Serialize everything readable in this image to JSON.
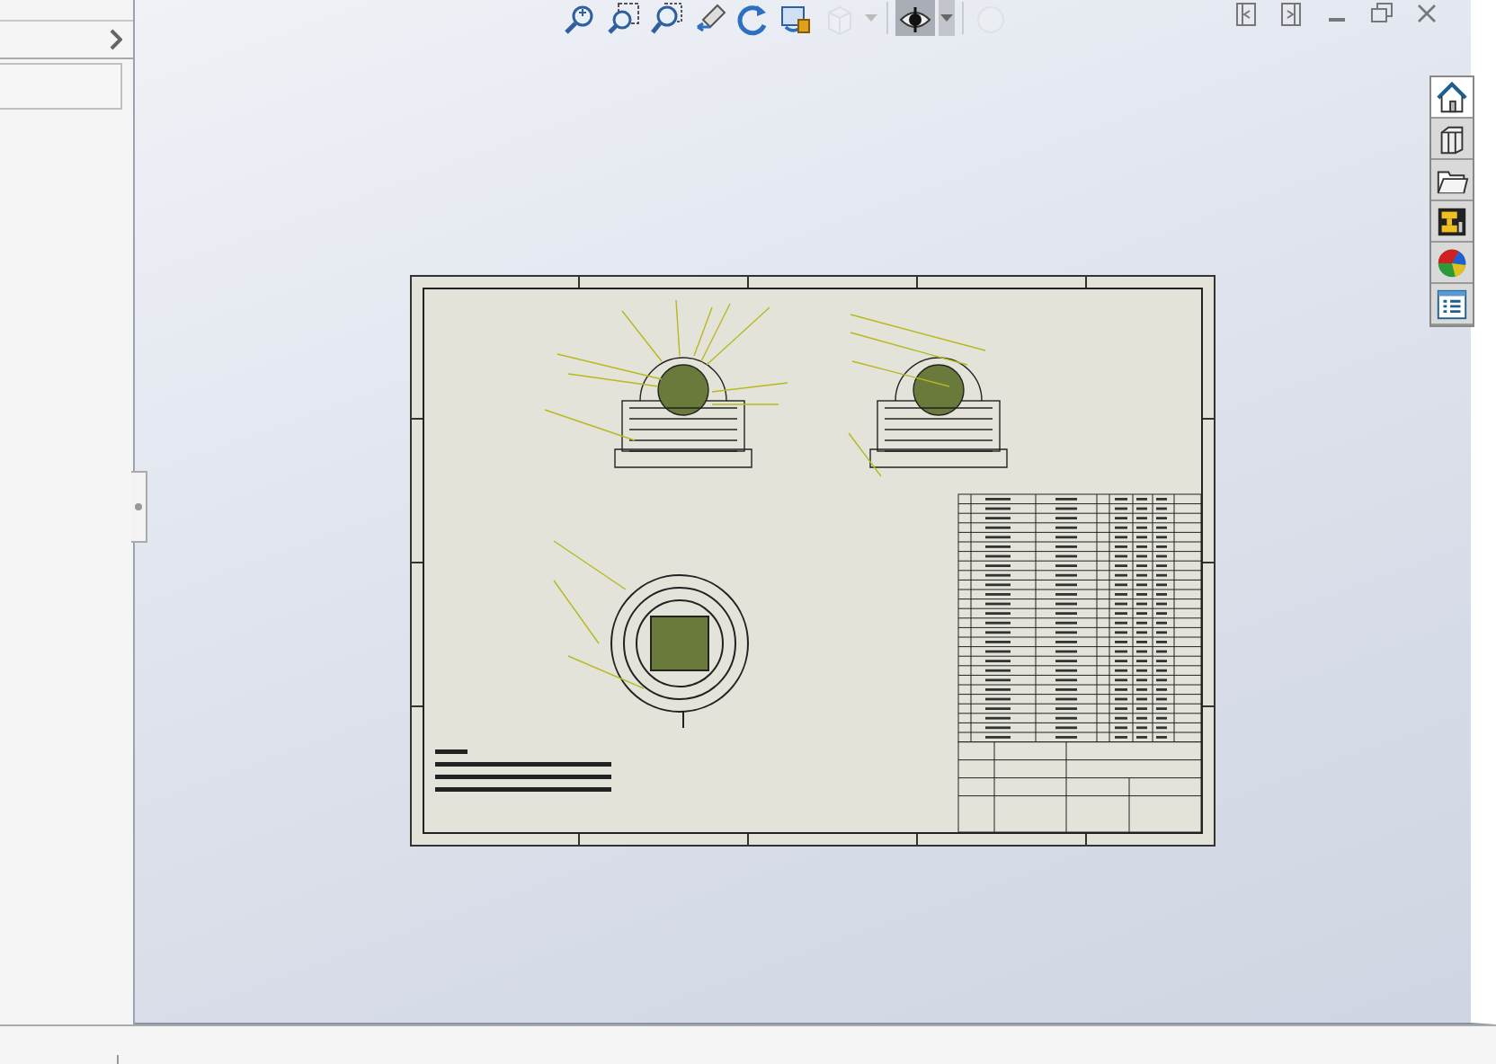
{
  "toolbar": {
    "buttons": [
      {
        "kind": "zoom-fit",
        "disabled": false,
        "pressed": false,
        "dropdown": false
      },
      {
        "kind": "zoom-area",
        "disabled": false,
        "pressed": false,
        "dropdown": false
      },
      {
        "kind": "zoom-box",
        "disabled": false,
        "pressed": false,
        "dropdown": false
      },
      {
        "kind": "previous-view",
        "disabled": false,
        "pressed": false,
        "dropdown": false
      },
      {
        "kind": "rotate",
        "disabled": false,
        "pressed": false,
        "dropdown": false
      },
      {
        "kind": "rebuild",
        "disabled": false,
        "pressed": false,
        "dropdown": false
      },
      {
        "kind": "cube",
        "disabled": true,
        "pressed": false,
        "dropdown": true
      },
      {
        "kind": "eye",
        "disabled": false,
        "pressed": true,
        "dropdown": true
      },
      {
        "kind": "sphere",
        "disabled": true,
        "pressed": false,
        "dropdown": false
      }
    ]
  },
  "window_controls": [
    {
      "kind": "tile-left"
    },
    {
      "kind": "tile-right"
    },
    {
      "kind": "minimize"
    },
    {
      "kind": "restore"
    },
    {
      "kind": "close"
    }
  ],
  "task_pane": {
    "tabs": [
      {
        "kind": "home",
        "selected": true
      },
      {
        "kind": "library",
        "selected": false
      },
      {
        "kind": "folder",
        "selected": false
      },
      {
        "kind": "palette",
        "selected": false
      },
      {
        "kind": "appearances",
        "selected": false
      },
      {
        "kind": "properties",
        "selected": false
      }
    ]
  },
  "sidebar": {
    "expanded": false
  }
}
